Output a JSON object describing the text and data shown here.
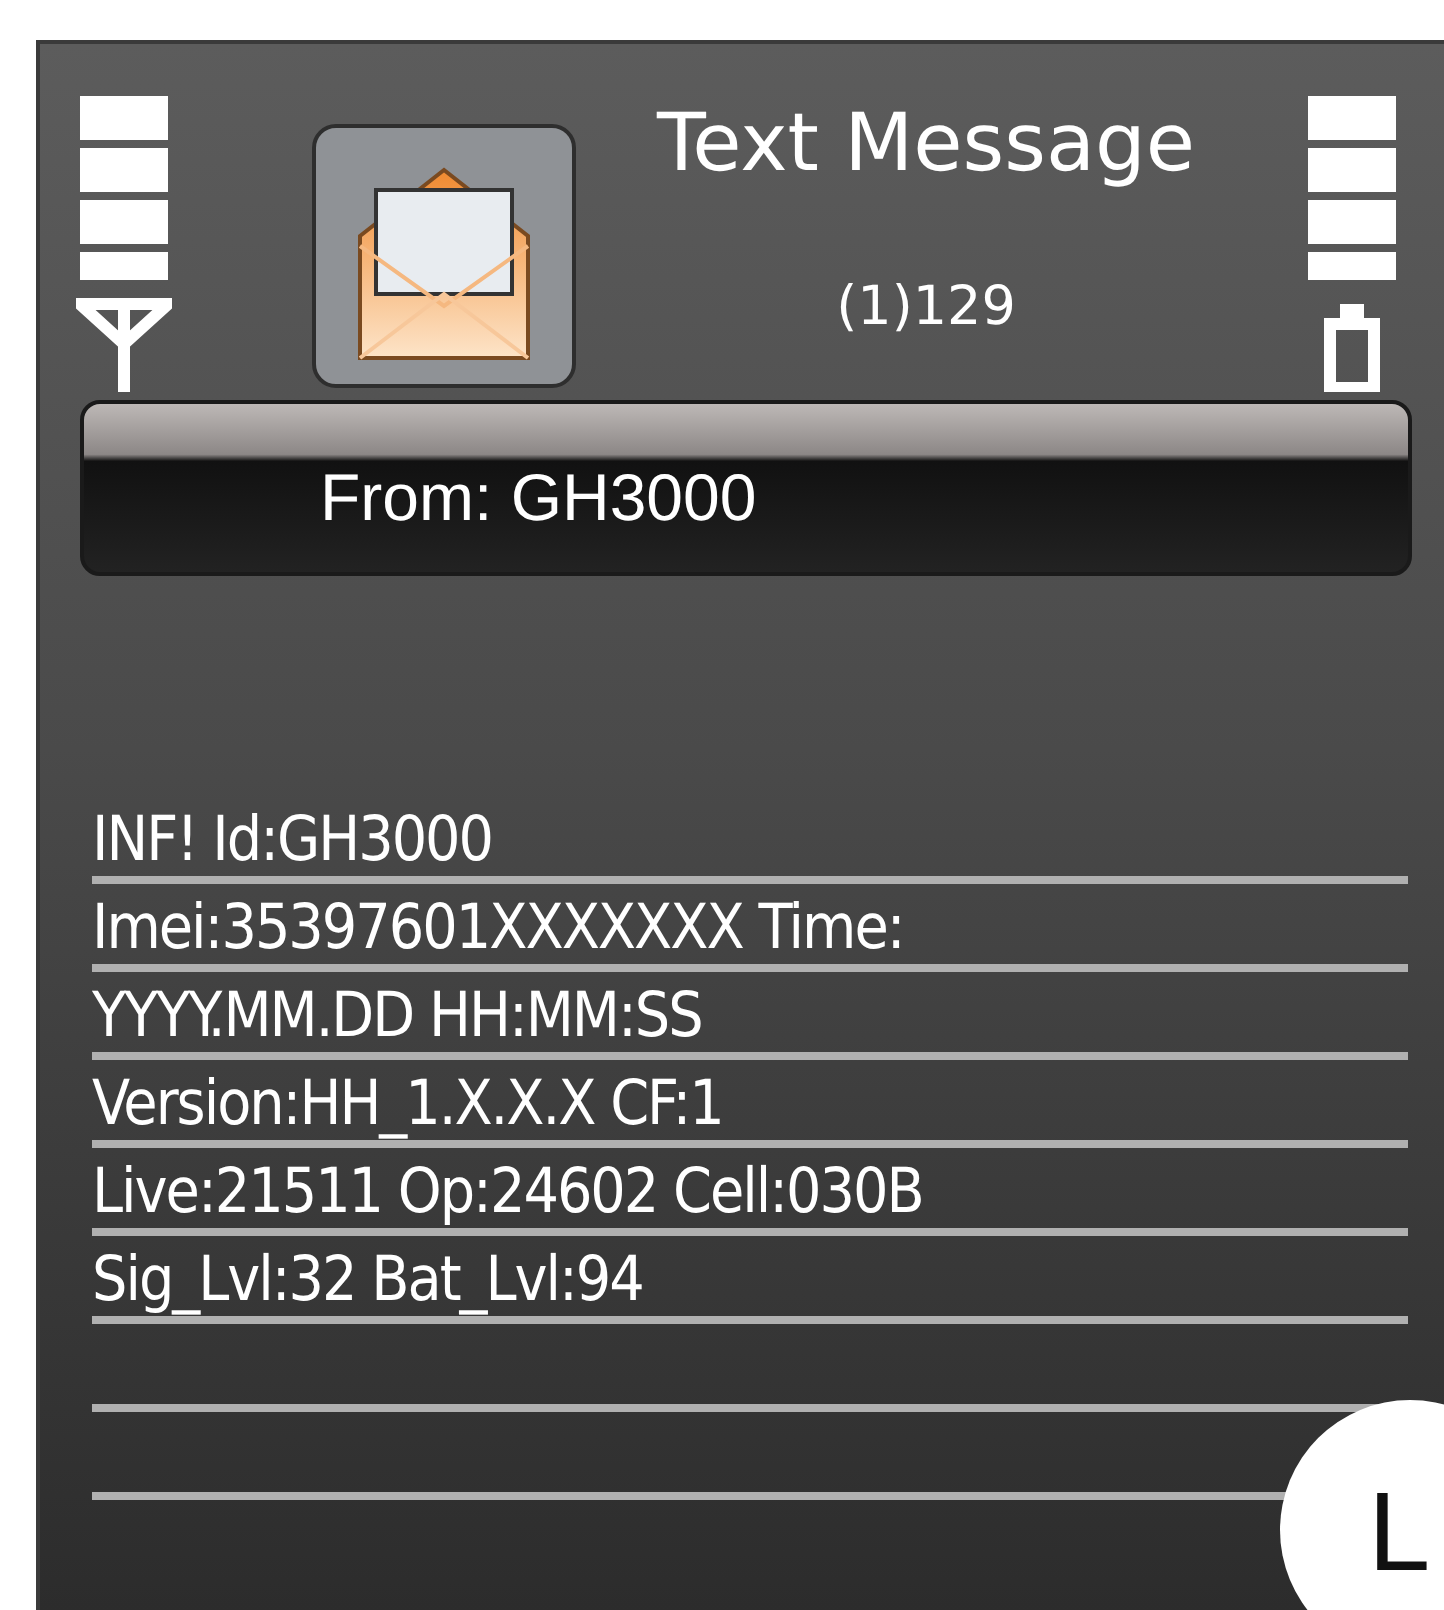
{
  "header": {
    "title": "Text Message",
    "count": "(1)129"
  },
  "sender": "From: GH3000",
  "message_lines": [
    "INF! Id:GH3000",
    "Imei:35397601XXXXXXX Time:",
    "YYYY.MM.DD HH:MM:SS",
    "Version:HH_1.X.X.X CF:1",
    "Live:21511 Op:24602 Cell:030B",
    "Sig_Lvl:32 Bat_Lvl:94"
  ],
  "corner_badge": "L"
}
